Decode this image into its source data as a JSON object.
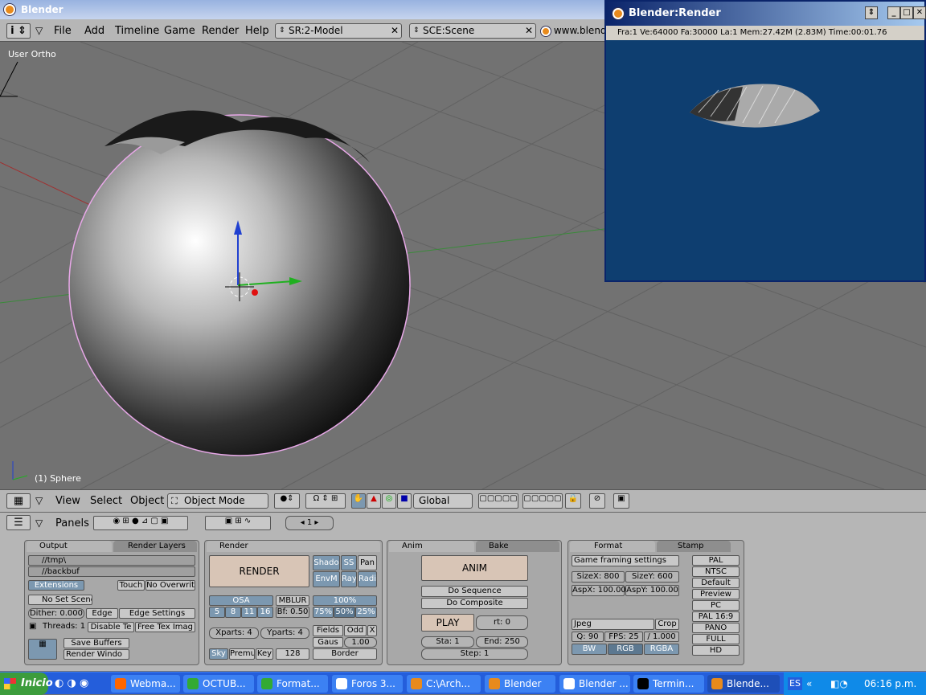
{
  "window": {
    "title": "Blender"
  },
  "menubar": {
    "items": [
      "File",
      "Add",
      "Timeline",
      "Game",
      "Render",
      "Help"
    ],
    "screen": "SR:2-Model",
    "scene": "SCE:Scene",
    "url": "www.blend"
  },
  "viewport": {
    "view_label": "User Ortho",
    "object_label": "(1) Sphere"
  },
  "view3d_header": {
    "items": [
      "View",
      "Select",
      "Object"
    ],
    "mode": "Object Mode",
    "orientation": "Global"
  },
  "buttons_header": {
    "label": "Panels",
    "frame": "1"
  },
  "output_panel": {
    "tabs": [
      "Output",
      "Render Layers"
    ],
    "path1": "//tmp\\",
    "path2": "//backbuf",
    "extensions": "Extensions",
    "touch": "Touch",
    "no_overwrite": "No Overwrit",
    "no_set_scene": "No Set Scene",
    "dither": "Dither: 0.000",
    "edge": "Edge",
    "edge_settings": "Edge Settings",
    "threads": "Threads: 1",
    "disable_tex": "Disable Te",
    "free_tex": "Free Tex Imag",
    "save_buffers": "Save Buffers",
    "render_window": "Render Windo"
  },
  "render_panel": {
    "tab": "Render",
    "render": "RENDER",
    "shadow": "Shado",
    "ss": "SS",
    "pan": "Pan",
    "envmap": "EnvM",
    "ray": "Ray",
    "radio": "Radi",
    "osa": "OSA",
    "osa_values": [
      "5",
      "8",
      "11",
      "16"
    ],
    "mblur": "MBLUR",
    "bf": "Bf: 0.50",
    "percent": [
      "100%",
      "75%",
      "50%",
      "25%"
    ],
    "xparts": "Xparts: 4",
    "yparts": "Yparts: 4",
    "fields": "Fields",
    "odd": "Odd",
    "x": "X",
    "filter": "Gaus",
    "filter_size": "1.00",
    "sky": "Sky",
    "premul": "Premul",
    "key": "Key",
    "bits": "128",
    "border": "Border"
  },
  "anim_panel": {
    "tabs": [
      "Anim",
      "Bake"
    ],
    "anim": "ANIM",
    "do_sequence": "Do Sequence",
    "do_composite": "Do Composite",
    "play": "PLAY",
    "rt": "rt: 0",
    "start": "Sta: 1",
    "end": "End: 250",
    "step": "Step: 1"
  },
  "format_panel": {
    "tabs": [
      "Format",
      "Stamp"
    ],
    "game_framing": "Game framing settings",
    "sizex": "SizeX: 800",
    "sizey": "SizeY: 600",
    "aspx": "AspX: 100.00",
    "aspy": "AspY: 100.00",
    "format": "Jpeg",
    "crop": "Crop",
    "quality": "Q: 90",
    "fps": "FPS: 25",
    "fps_base": "/ 1.000",
    "bw": "BW",
    "rgb": "RGB",
    "rgba": "RGBA",
    "presets": [
      "PAL",
      "NTSC",
      "Default",
      "Preview",
      "PC",
      "PAL 16:9",
      "PANO",
      "FULL",
      "HD"
    ]
  },
  "render_window": {
    "title": "Blender:Render",
    "stats": "Fra:1  Ve:64000 Fa:30000 La:1 Mem:27.42M (2.83M) Time:00:01.76"
  },
  "taskbar": {
    "start": "Inicio",
    "tasks": [
      "Webma...",
      "OCTUB...",
      "Format...",
      "Foros 3...",
      "C:\\Arch...",
      "Blender",
      "Blender ...",
      "Termin...",
      "Blende..."
    ],
    "lang": "ES",
    "clock": "06:16 p.m."
  },
  "colors": {
    "accent": "#0a246a",
    "render_bg": "#0e3e70",
    "taskbar": "#245edb",
    "selected_button": "#7c98b0"
  }
}
